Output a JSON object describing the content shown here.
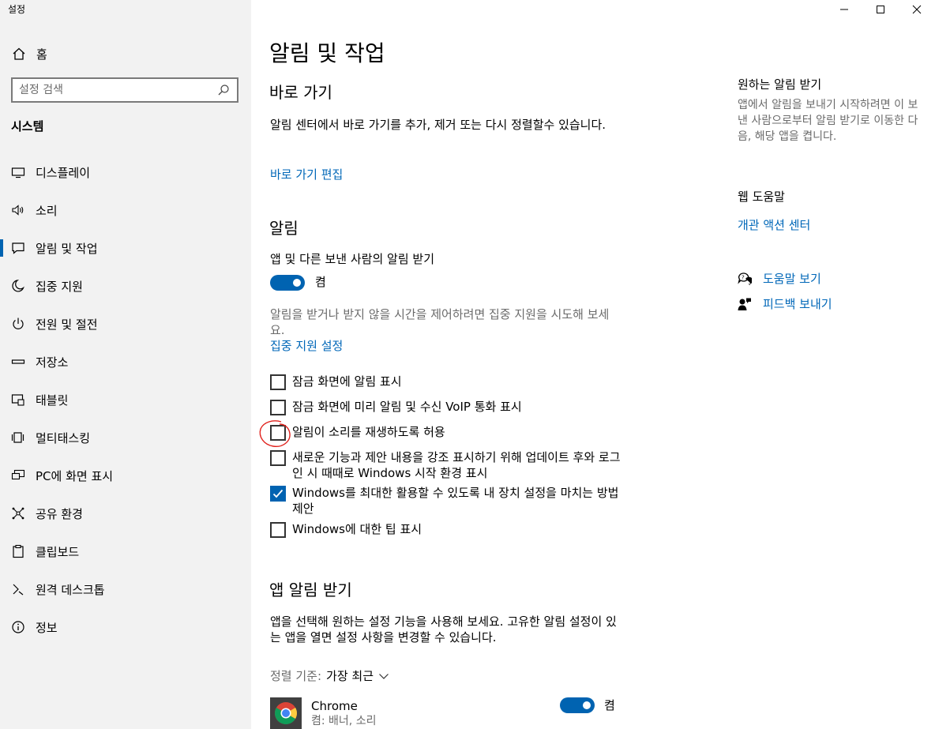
{
  "window": {
    "title": "설정",
    "controls": {
      "minimize": "minimize-icon",
      "maximize": "maximize-icon",
      "close": "close-icon"
    }
  },
  "sidebar": {
    "home_label": "홈",
    "search": {
      "placeholder": "설정 검색",
      "value": ""
    },
    "section_title": "시스템",
    "items": [
      {
        "label": "디스플레이",
        "icon": "display-icon"
      },
      {
        "label": "소리",
        "icon": "speaker-icon"
      },
      {
        "label": "알림 및 작업",
        "icon": "notification-icon",
        "active": true
      },
      {
        "label": "집중 지원",
        "icon": "moon-icon"
      },
      {
        "label": "전원 및 절전",
        "icon": "power-icon"
      },
      {
        "label": "저장소",
        "icon": "storage-icon"
      },
      {
        "label": "태블릿",
        "icon": "tablet-icon"
      },
      {
        "label": "멀티태스킹",
        "icon": "multitasking-icon"
      },
      {
        "label": "PC에 화면 표시",
        "icon": "project-icon"
      },
      {
        "label": "공유 환경",
        "icon": "shared-experiences-icon"
      },
      {
        "label": "클립보드",
        "icon": "clipboard-icon"
      },
      {
        "label": "원격 데스크톱",
        "icon": "remote-desktop-icon"
      },
      {
        "label": "정보",
        "icon": "info-icon"
      }
    ]
  },
  "main": {
    "title": "알림 및 작업",
    "quick_actions": {
      "heading": "바로 가기",
      "description": "알림 센터에서 바로 가기를 추가, 제거 또는 다시 정렬할수 있습니다.",
      "edit_link": "바로 가기 편집"
    },
    "notifications": {
      "heading": "알림",
      "toggle_label": "앱 및 다른 보낸 사람의 알림 받기",
      "toggle_state": "켬",
      "toggle_on": true,
      "focus_hint": "알림을 받거나 받지 않을 시간을 제어하려면 집중 지원을 시도해 보세요.",
      "focus_link": "집중 지원 설정",
      "checkboxes": [
        {
          "label": "잠금 화면에 알림 표시",
          "checked": false
        },
        {
          "label": "잠금 화면에 미리 알림 및 수신 VoIP 통화 표시",
          "checked": false
        },
        {
          "label": "알림이 소리를 재생하도록 허용",
          "checked": false
        },
        {
          "label": "새로운 기능과 제안 내용을 강조 표시하기 위해 업데이트 후와 로그인 시 때때로 Windows 시작 환경 표시",
          "checked": false
        },
        {
          "label": "Windows를 최대한 활용할 수 있도록 내 장치 설정을 마치는 방법 제안",
          "checked": true
        },
        {
          "label": "Windows에 대한 팁 표시",
          "checked": false
        }
      ]
    },
    "app_notifications": {
      "heading": "앱 알림 받기",
      "description": "앱을 선택해 원하는 설정 기능을 사용해 보세요. 고유한 알림 설정이 있는 앱을 열면 설정 사항을 변경할 수 있습니다.",
      "sort_label": "정렬 기준:",
      "sort_value": "가장 최근",
      "apps": [
        {
          "name": "Chrome",
          "detail": "켬: 배너, 소리",
          "state": "켬",
          "on": true,
          "icon": "chrome-icon"
        }
      ]
    }
  },
  "right": {
    "get_notifications": {
      "heading": "원하는 알림 받기",
      "text": "앱에서 알림을 보내기 시작하려면 이 보낸 사람으로부터 알림 받기로 이동한 다음, 해당 앱을 켭니다."
    },
    "web_help": {
      "heading": "웹 도움말",
      "link": "개관 액션 센터"
    },
    "get_help": "도움말 보기",
    "feedback": "피드백 보내기"
  },
  "annotation": {
    "color": "#e0201b"
  },
  "colors": {
    "accent": "#0063b1",
    "link": "#0067b8",
    "sidebar_bg": "#f2f2f2"
  }
}
